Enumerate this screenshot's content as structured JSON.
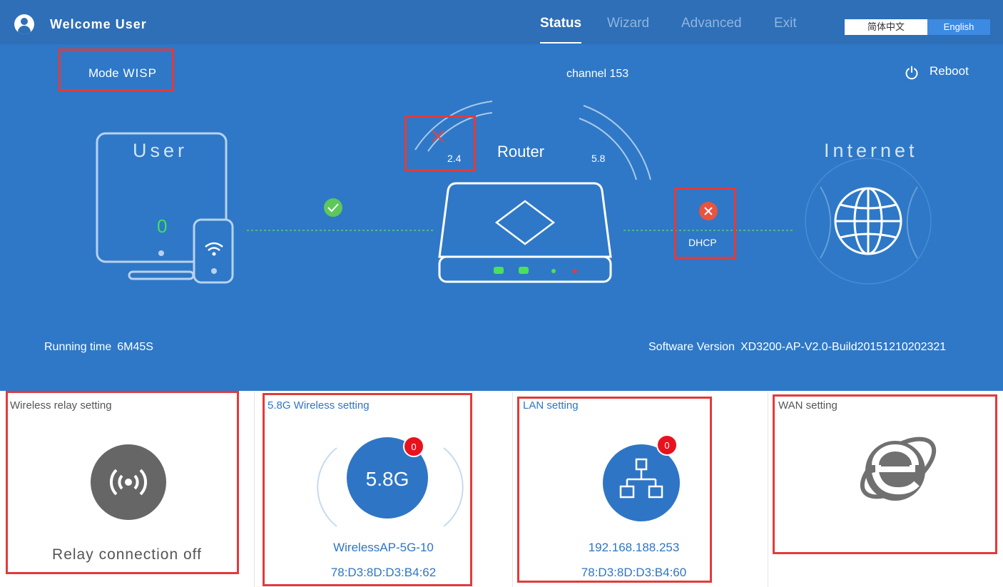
{
  "header": {
    "welcome": "Welcome User",
    "nav": [
      {
        "label": "Status",
        "active": true
      },
      {
        "label": "Wizard",
        "active": false
      },
      {
        "label": "Advanced",
        "active": false
      },
      {
        "label": "Exit",
        "active": false
      }
    ],
    "lang_cn": "简体中文",
    "lang_en": "English"
  },
  "status": {
    "mode_label": "Mode",
    "mode_value": "WISP",
    "channel": "channel 153",
    "reboot": "Reboot",
    "user_label": "User",
    "user_count": "0",
    "router_label": "Router",
    "band_24": "2.4",
    "band_58": "5.8",
    "internet_label": "Internet",
    "wan_proto": "DHCP",
    "running_label": "Running time",
    "running_value": "6M45S",
    "software_label": "Software Version",
    "software_value": "XD3200-AP-V2.0-Build20151210202321"
  },
  "cards": {
    "relay": {
      "title": "Wireless relay setting",
      "status": "Relay connection off"
    },
    "wireless58": {
      "title": "5.8G Wireless setting",
      "badge": "0",
      "icon_text": "5.8G",
      "ssid": "WirelessAP-5G-10",
      "mac": "78:D3:8D:D3:B4:62"
    },
    "lan": {
      "title": "LAN setting",
      "badge": "0",
      "ip": "192.168.188.253",
      "mac": "78:D3:8D:D3:B4:60"
    },
    "wan": {
      "title": "WAN setting"
    }
  },
  "colors": {
    "topbar": "#2e6fb7",
    "hero": "#2e78c7",
    "ok_green": "#5cc85a",
    "error_red": "#e8543f",
    "highlight_box": "#e33a3a",
    "badge_red": "#e8121f"
  }
}
